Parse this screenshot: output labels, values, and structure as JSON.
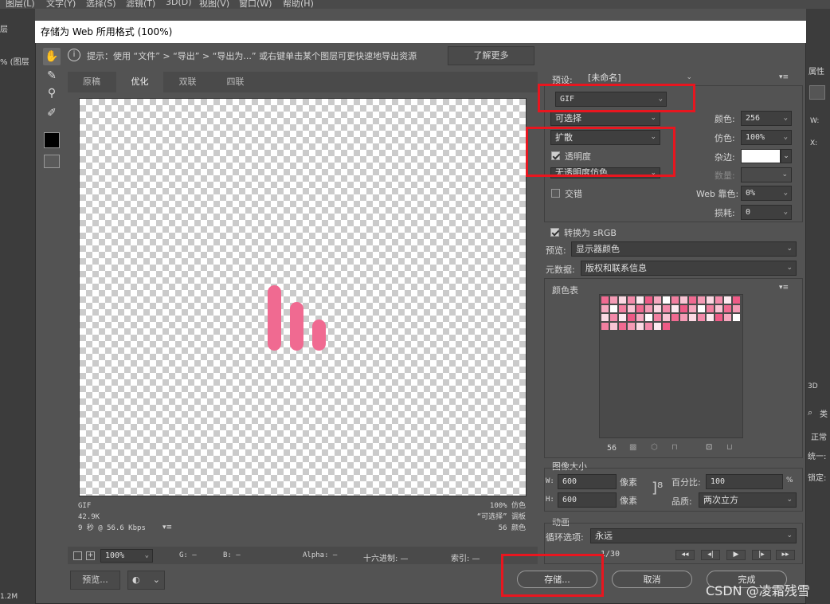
{
  "menubar": {
    "items": [
      "图层(L)",
      "文字(Y)",
      "选择(S)",
      "滤镜(T)",
      "3D(D)",
      "视图(V)",
      "窗口(W)",
      "帮助(H)"
    ]
  },
  "background": {
    "doc_tab": "% (图层",
    "left_label": "层",
    "left_bottom": "1.2M",
    "right_label": "属性",
    "right_w": "W:",
    "right_x": "X:",
    "right_3d": "3D",
    "right_find": "类",
    "right_normal": "正常",
    "right_unify": "统一:",
    "right_lock": "锁定:"
  },
  "dialog": {
    "title": "存储为 Web 所用格式 (100%)",
    "hint": {
      "text": "提示：使用 “文件” > “导出” > “导出为...” 或右键单击某个图层可更快速地导出资源",
      "button": "了解更多"
    },
    "tabs": [
      "原稿",
      "优化",
      "双联",
      "四联"
    ],
    "status": {
      "left": [
        "GIF",
        "42.9K",
        "9 秒 @ 56.6 Kbps"
      ],
      "right": [
        "100% 仿色",
        "“可选择” 调板",
        "56 颜色"
      ]
    },
    "bottombar": {
      "zoom": "100%",
      "g": "G: —",
      "b": "B: —",
      "alpha": "Alpha: —",
      "hex": "十六进制: —",
      "index": "索引: —"
    },
    "buttons": {
      "preview": "预览...",
      "save": "存储...",
      "cancel": "取消",
      "done": "完成"
    },
    "settings": {
      "preset_label": "预设:",
      "preset_value": "[未命名]",
      "format": "GIF",
      "reduction": "可选择",
      "dither_algo": "扩散",
      "transparency_label": "透明度",
      "trans_dither": "无透明度仿色",
      "interlaced_label": "交错",
      "colors_label": "颜色:",
      "colors_value": "256",
      "dither_label": "仿色:",
      "dither_value": "100%",
      "matte_label": "杂边:",
      "amount_label": "数量:",
      "websnap_label": "Web 靠色:",
      "websnap_value": "0%",
      "lossy_label": "损耗:",
      "lossy_value": "0",
      "convert_label": "转换为 sRGB",
      "preview_label": "预览:",
      "preview_value": "显示器颜色",
      "metadata_label": "元数据:",
      "metadata_value": "版权和联系信息"
    },
    "colortable": {
      "title": "颜色表",
      "count": "56"
    },
    "imagesize": {
      "title": "图像大小",
      "w_label": "W:",
      "w_value": "600",
      "w_unit": "像素",
      "h_label": "H:",
      "h_value": "600",
      "h_unit": "像素",
      "percent_label": "百分比:",
      "percent_value": "100",
      "percent_unit": "%",
      "quality_label": "品质:",
      "quality_value": "两次立方"
    },
    "animation": {
      "title": "动画",
      "loop_label": "循环选项:",
      "loop_value": "永远",
      "frame": "1/30"
    }
  },
  "watermark": "CSDN @凌霜残雪",
  "colors": {
    "accent_red": "#e8161f",
    "bar_pink": "#f06a91",
    "titlebar": "#ffffff"
  }
}
